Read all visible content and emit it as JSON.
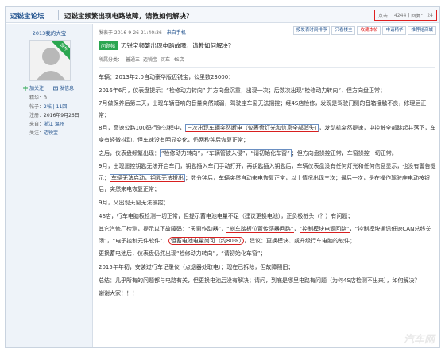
{
  "header": {
    "forum_name": "迈锐宝论坛",
    "thread_title": "迈锐宝频繁出现电路故障，请教如何解决？",
    "stats_label_views": "点击：",
    "stats_views": "4244",
    "stats_sep": "|",
    "stats_label_replies": "回复：",
    "stats_replies": "24"
  },
  "user": {
    "name": "2013我的大宝",
    "badge": "铁杆",
    "follow_label": "加关注",
    "message_label": "发信息",
    "stats": [
      {
        "label": "精华：",
        "value": "0"
      },
      {
        "label": "帖子：",
        "value": "2帖 | 11回"
      },
      {
        "label": "注册：",
        "value": "2016年9月26日"
      },
      {
        "label": "来自：",
        "value": "浙江 温州"
      },
      {
        "label": "关注：",
        "value": "迈锐宝"
      }
    ]
  },
  "post": {
    "meta_prefix": "发表于 2016-9-26 21:40:36",
    "meta_sep": "|",
    "meta_app": "来自手机",
    "tools": [
      "按发表时间排序",
      "只看楼主",
      "收藏本帖",
      "申请精华",
      "推荐给商城"
    ],
    "tag": "问题帖",
    "subject": "迈锐宝频繁出现电路故障，请教如何解决？",
    "tags_label": "所属分类：",
    "tags": [
      "普通三",
      "迈锐宝",
      "买车",
      "4S店"
    ],
    "paragraphs": [
      {
        "a": "车辆：2013年2.0自动豪华版迈锐宝，公里数23000；"
      },
      {
        "a": "2016年6月，仪表盘提示：“检修动力转向” 并方向盘沉重，出现一次；后数次出现“检修动力转向”，但方向盘正常；"
      },
      {
        "a": "7月做保养后第二天，出现车辆音响的音量突然减弱，驾驶座车窗无法摇控；经4S店检修，发现是驾驶门侧的音箱接触不良，修理后正常；"
      },
      {
        "a": "8月，高速公路100码行驶过程中，",
        "b": "三次出现车辆突然断电（仪表盘灯光和信息全部消失）",
        "c": "，发动机突然提速，中控触全部跳起并落下，车身有轻微抖动，但车速没有明显变化，仍两秒钟后恢复正常；"
      },
      {
        "a": "之后，仪表盘频繁出现：",
        "b": "“检修动力转向”，“车辆管被入侵”，“请初始化车窗”",
        "c": "；但方向盘操控正常，车窗操控一切正常。"
      },
      {
        "a": "9月，出现遥控钥匙无法开启车门，钥匙插入车门手动打开，再钥匙插入钥匙后，车辆仪表盘没有任何灯光和任何信息显示，也没有警告提示；",
        "b": "车辆无法启动，钥匙无法拔出",
        "c": "；数分钟后，车辆突然自动来电恢复正常，以上情况出现三次；最后一次，是在操作驾驶座电动按钮后，突然来电恢复正常；"
      },
      {
        "a": "9月，又出现天窗无法操控；"
      },
      {
        "a": "4S店，行车电脑板检测一切正常，但提示蓄电池电量不足（建议更换电池），正负极桩头（？）有问题；"
      },
      {
        "a": "其它汽修厂检测，提示以下故障码：“天窗作动器”，",
        "b": "“刹车踏板位置传感器回路”",
        "c": "，",
        "d": "“控制模块电源回路”",
        "e": "，“控制模块通讯低速CAN总线关闭”，“电子控制元件软件”，",
        "f": "但蓄电池电量尚可（约80%）",
        "g": "，建议：更换模块、或升级行车电脑的软件；"
      },
      {
        "a": "更换蓄电池后，仪表盘仍然出现“检修动力转向”，“请初始化车窗”；"
      },
      {
        "a": "2015年年初，安装过行车记录仪（点烟器处取电）；现在已拆除，但故障照旧；"
      },
      {
        "a": "总结：几乎所有的问题都与电路有关，但更换电池后没有解决；请问，到底是哪里电路有问题（为何4S店检测不出来），如何解决？"
      },
      {
        "a": "谢谢大家！！！"
      }
    ]
  },
  "watermark": "汽车网"
}
